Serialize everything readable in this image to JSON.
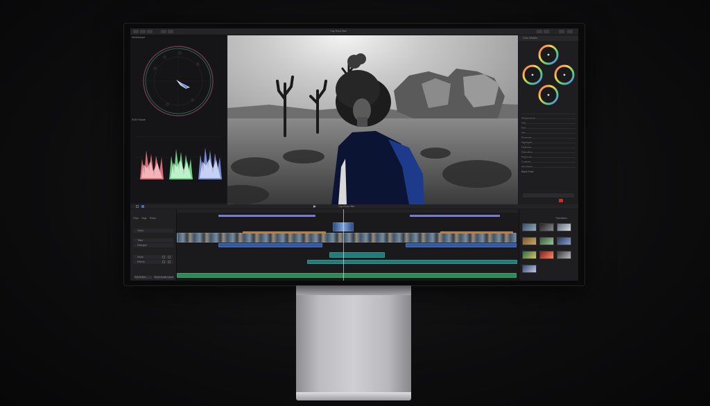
{
  "toolbar": {
    "project_title": "Cap Rock Hike"
  },
  "scopes": {
    "vectorscope_label": "Vectorscope",
    "waveform_label": "RGB Parade"
  },
  "inspector": {
    "title": "Color Wheels",
    "rows": [
      "Temperature",
      "Tint",
      "Hue",
      "Mix",
      "Shadows",
      "Highlights",
      "Midtones",
      "Saturation",
      "Exposure",
      "Contrast",
      "Mid Detail",
      "Black Point"
    ]
  },
  "timeline": {
    "index_tabs": [
      "Clips",
      "Tags",
      "Roles"
    ],
    "roles": [
      "Video",
      "Titles",
      "Dialogue",
      "Music",
      "Effects"
    ],
    "buttons": [
      "Edit Roles",
      "Show Audio Lanes"
    ],
    "playhead_label": "Cap Rock Hike"
  },
  "browser": {
    "title": "Transitions"
  },
  "colors": {
    "accent_blue": "#3f6fc4",
    "clip_purple": "#6b6fcf",
    "clip_orange": "#b8762e",
    "audio_blue": "#2f5aa8",
    "music_teal": "#1f7c78",
    "music_green": "#2b8a55"
  },
  "icons": [
    "search-icon",
    "gear-icon",
    "play-icon"
  ]
}
